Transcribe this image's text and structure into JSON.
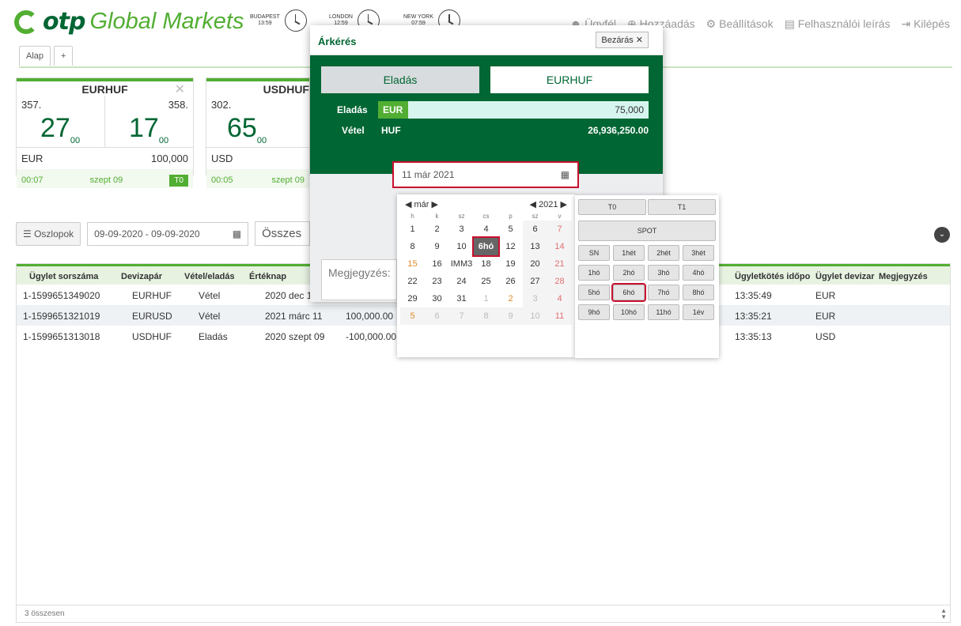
{
  "header": {
    "logo_otp": "otp",
    "logo_gm": "Global Markets",
    "clocks": [
      {
        "city": "BUDAPEST",
        "time": "13:59"
      },
      {
        "city": "LONDON",
        "time": "12:59"
      },
      {
        "city": "NEW YORK",
        "time": "07:59"
      }
    ],
    "nav": [
      "Ügyfél",
      "Hozzáadás",
      "Beállítások",
      "Felhasználói leírás",
      "Kilépés"
    ]
  },
  "tabs": {
    "active": "Alap",
    "add": "+"
  },
  "cards": [
    {
      "pair": "EURHUF",
      "bid_small": "357.",
      "bid_big": "27",
      "bid_sub": "00",
      "ask_small": "358.",
      "ask_big": "17",
      "ask_sub": "00",
      "ccy": "EUR",
      "amount": "100,000",
      "time": "00:07",
      "date": "szept 09",
      "tenor": "T0"
    },
    {
      "pair": "USDHUF",
      "bid_small": "302.",
      "bid_big": "65",
      "bid_sub": "00",
      "ccy": "USD",
      "time": "00:05",
      "date": "szept 09"
    }
  ],
  "filter": {
    "columns_btn": "Oszlopok",
    "date_range": "09-09-2020 - 09-09-2020",
    "select": "Összes"
  },
  "grid": {
    "headers": [
      "Ügylet sorszáma",
      "Devizapár",
      "Vétel/eladás",
      "Értéknap",
      "",
      "Ügyletkötés időpo",
      "Ügylet devizar",
      "Megjegyzés"
    ],
    "rows": [
      [
        "1-1599651349020",
        "EURHUF",
        "Vétel",
        "2020 dec 1",
        "",
        "13:35:49",
        "EUR",
        ""
      ],
      [
        "1-1599651321019",
        "EURUSD",
        "Vétel",
        "2021 márc 11",
        "100,000.00",
        "13:35:21",
        "EUR",
        ""
      ],
      [
        "1-1599651313018",
        "USDHUF",
        "Eladás",
        "2020 szept 09",
        "-100,000.00",
        "13:35:13",
        "USD",
        ""
      ]
    ],
    "footer": "3 összesen"
  },
  "modal": {
    "title": "Árkérés",
    "close": "Bezárás",
    "side_btn": "Eladás",
    "pair_btn": "EURHUF",
    "sell_label": "Eladás",
    "sell_ccy": "EUR",
    "sell_amount": "75,000",
    "buy_label": "Vétel",
    "buy_ccy": "HUF",
    "buy_amount": "26,936,250.00",
    "date": "11 már 2021",
    "note_label": "Megjegyzés:"
  },
  "calendar": {
    "month": "már",
    "year": "2021",
    "weekdays": [
      "h",
      "k",
      "sz",
      "cs",
      "p",
      "sz",
      "v"
    ],
    "weeks": [
      [
        "1",
        "2",
        "3",
        "4",
        "5",
        "6",
        "7"
      ],
      [
        "8",
        "9",
        "10",
        "6hó",
        "12",
        "13",
        "14"
      ],
      [
        "15",
        "16",
        "IMM3",
        "18",
        "19",
        "20",
        "21"
      ],
      [
        "22",
        "23",
        "24",
        "25",
        "26",
        "27",
        "28"
      ],
      [
        "29",
        "30",
        "31",
        "1",
        "2",
        "3",
        "4"
      ],
      [
        "5",
        "6",
        "7",
        "8",
        "9",
        "10",
        "11"
      ]
    ]
  },
  "quick": {
    "row1": [
      "T0",
      "T1"
    ],
    "spot": "SPOT",
    "row3": [
      "SN",
      "1hét",
      "2hét",
      "3hét"
    ],
    "row4": [
      "1hó",
      "2hó",
      "3hó",
      "4hó"
    ],
    "row5": [
      "5hó",
      "6hó",
      "7hó",
      "8hó"
    ],
    "row6": [
      "9hó",
      "10hó",
      "11hó",
      "1év"
    ]
  }
}
